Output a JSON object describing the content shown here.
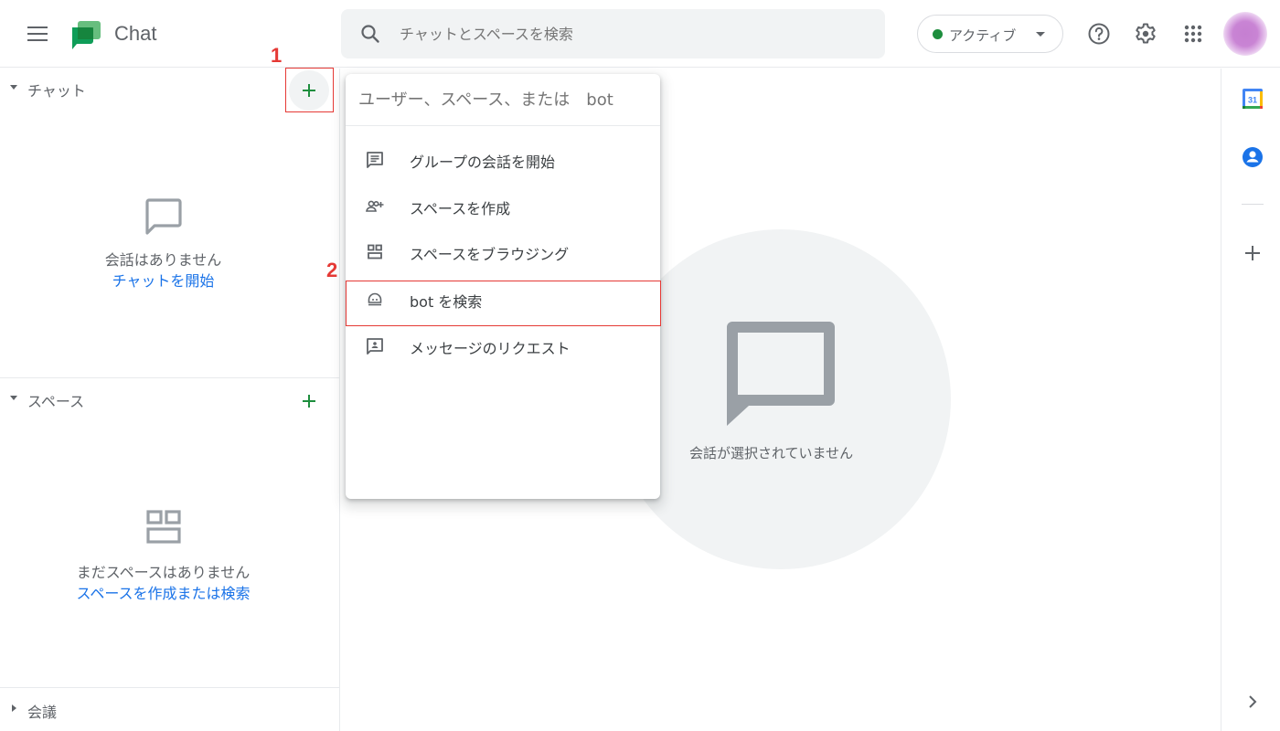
{
  "header": {
    "app_title": "Chat",
    "search_placeholder": "チャットとスペースを検索",
    "status_label": "アクティブ",
    "status_color": "#1e8e3e",
    "icons": [
      "menu-icon",
      "chat-logo-icon",
      "search-icon",
      "help-icon",
      "settings-icon",
      "apps-grid-icon",
      "avatar"
    ]
  },
  "sidebar": {
    "chat_section": {
      "label": "チャット",
      "empty_text": "会話はありません",
      "empty_link": "チャットを開始"
    },
    "spaces_section": {
      "label": "スペース",
      "empty_text": "まだスペースはありません",
      "empty_link": "スペースを作成または検索"
    },
    "meetings_section": {
      "label": "会議"
    }
  },
  "dropdown": {
    "input_placeholder": "ユーザー、スペース、または　bot",
    "items": [
      {
        "label": "グループの会話を開始",
        "icon": "chat-lines-icon"
      },
      {
        "label": "スペースを作成",
        "icon": "group-add-icon"
      },
      {
        "label": "スペースをブラウジング",
        "icon": "browse-spaces-icon"
      },
      {
        "label": "bot を検索",
        "icon": "bot-icon"
      },
      {
        "label": "メッセージのリクエスト",
        "icon": "message-request-icon"
      }
    ]
  },
  "main": {
    "empty_text": "会話が選択されていません"
  },
  "rail": {
    "calendar_label": "31",
    "icons": [
      "calendar-icon",
      "contacts-icon",
      "add-app-icon",
      "expand-icon"
    ]
  },
  "annotations": {
    "step1": "1",
    "step2": "2",
    "color": "#e53935"
  },
  "colors": {
    "accent_green": "#1e8e3e",
    "link_blue": "#1a73e8",
    "search_bg": "#f1f3f4"
  }
}
